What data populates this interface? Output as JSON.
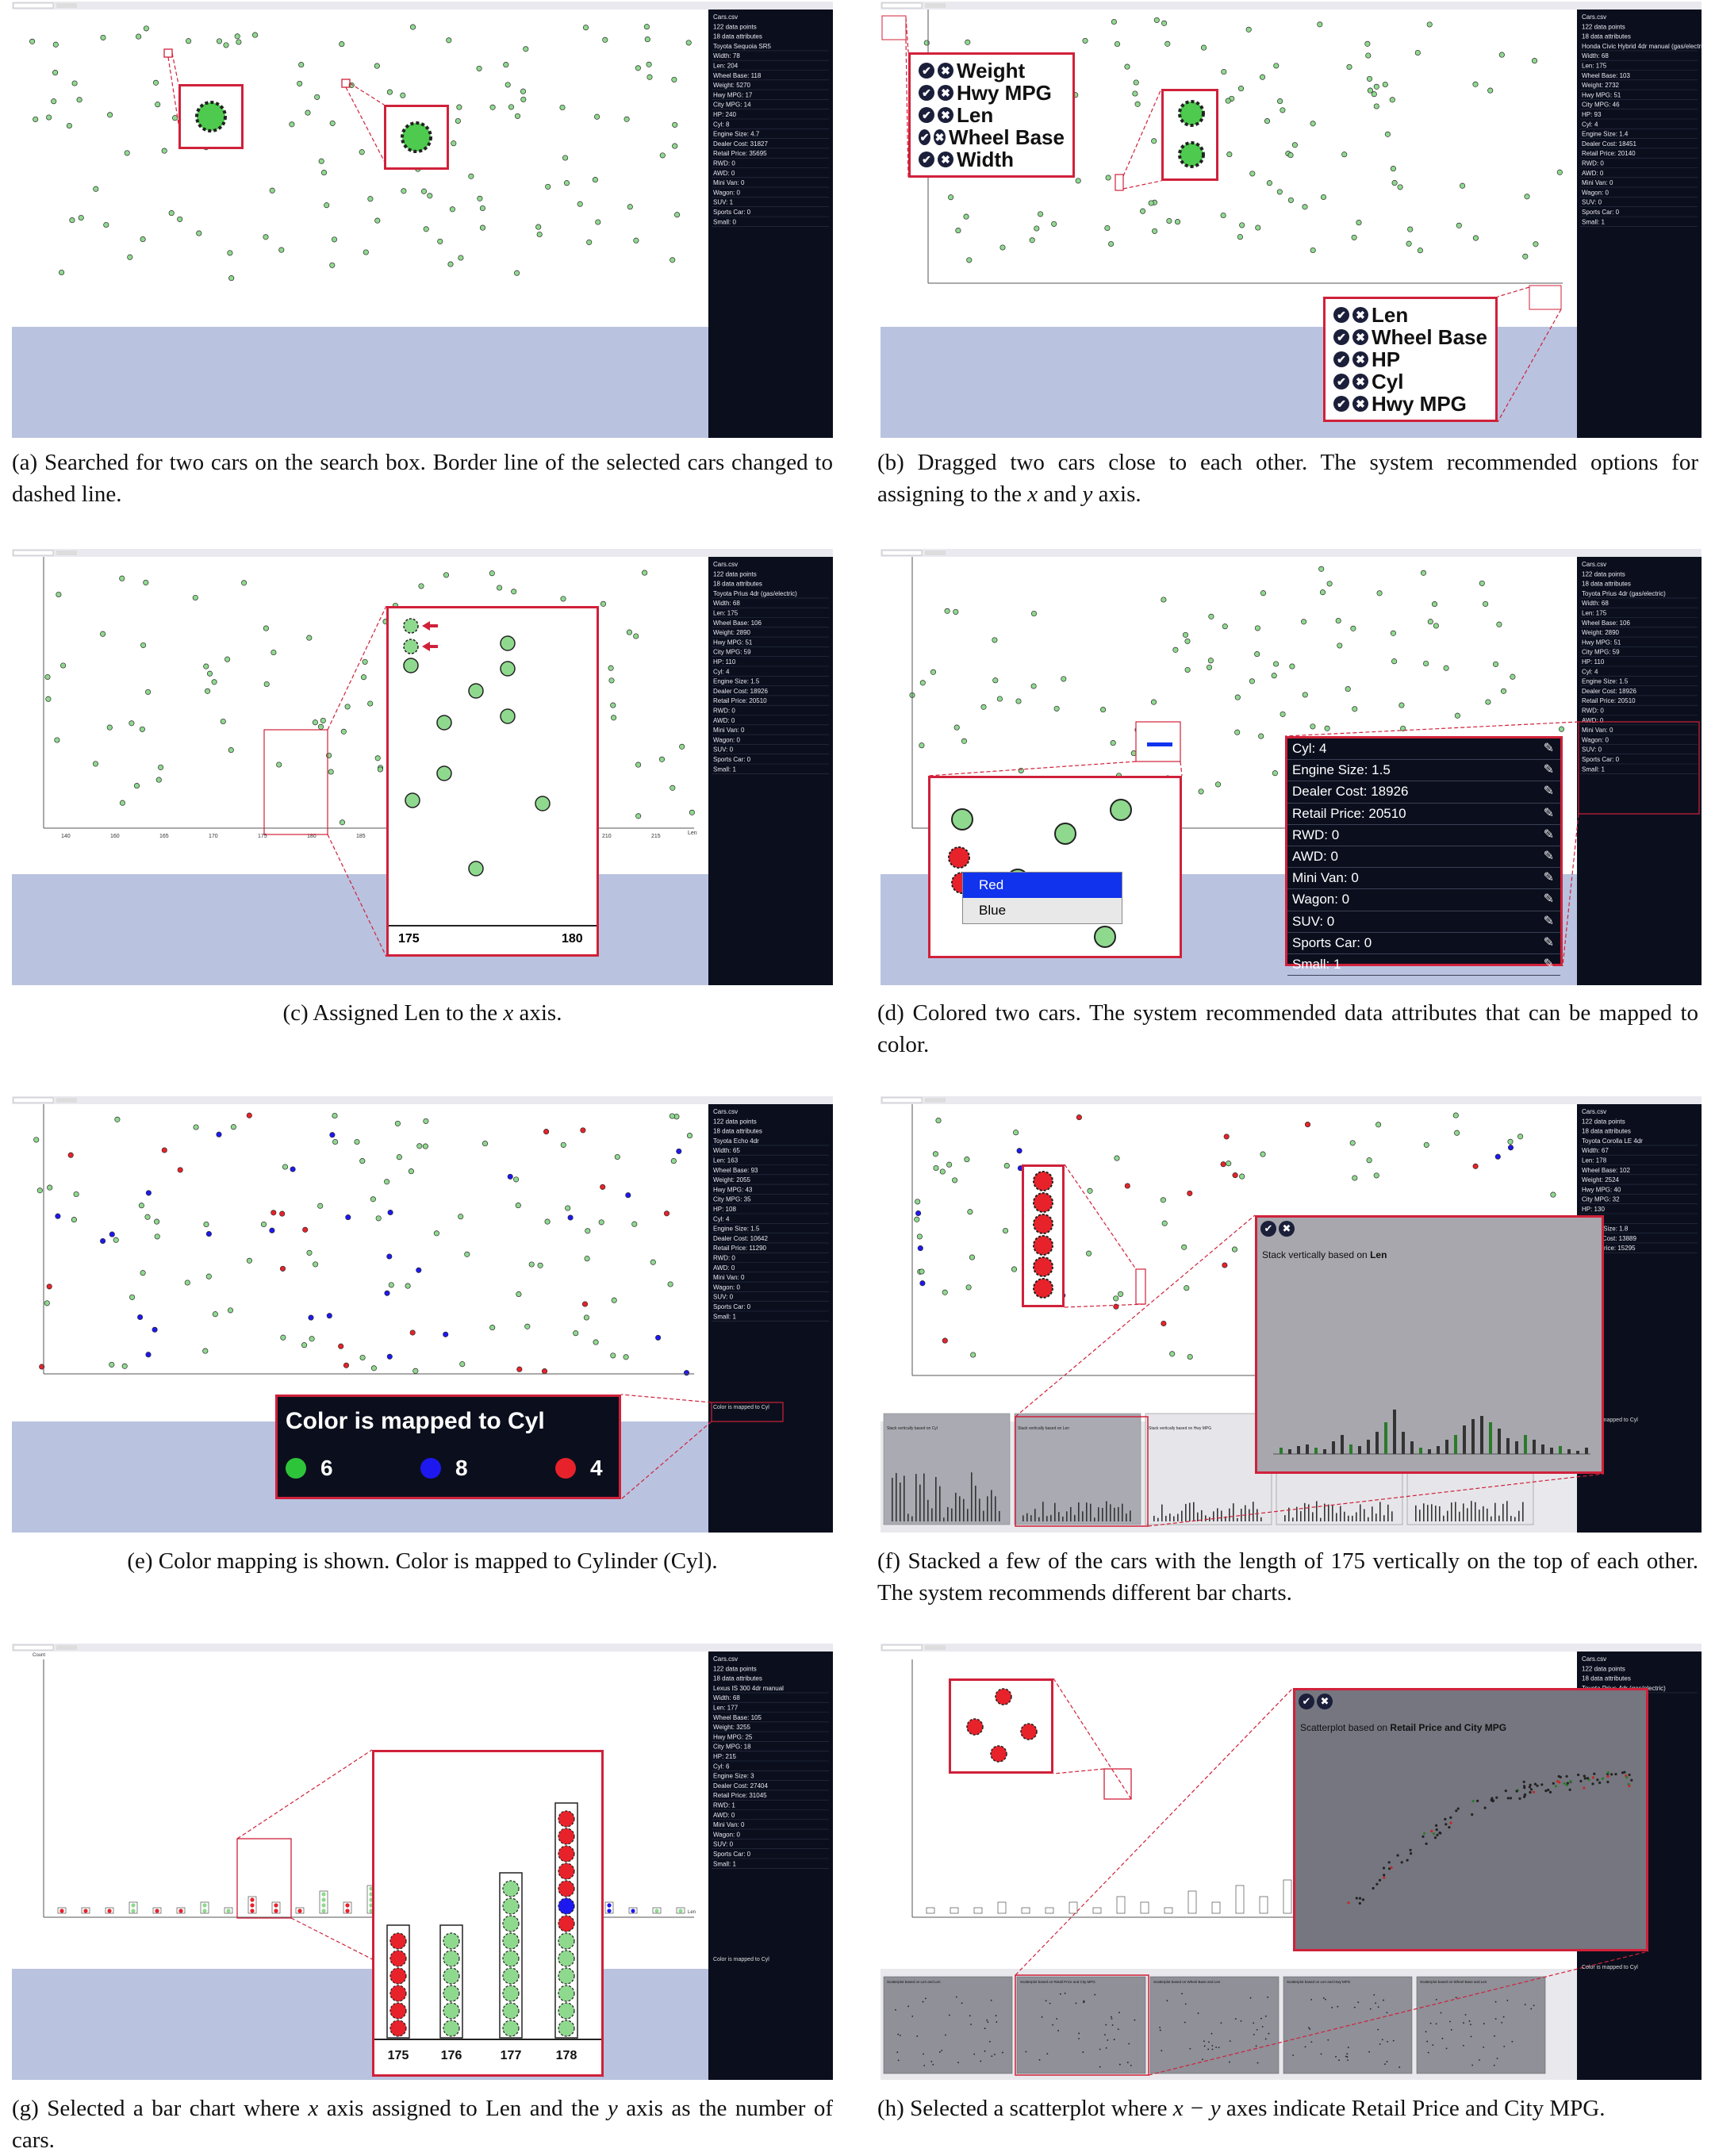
{
  "panels": {
    "a": {
      "search_text": "Enter Car Name",
      "clear_label": "Search Clear",
      "info": {
        "file": "Cars.csv",
        "points": "122 data points",
        "attrs": "18 data attributes",
        "car": "Toyota Sequoia SR5",
        "rows": [
          "Width: 78",
          "Len: 204",
          "Wheel Base: 118",
          "Weight: 5270",
          "Hwy MPG: 17",
          "City MPG: 14",
          "HP: 240",
          "Cyl: 8",
          "Engine Size: 4.7",
          "Dealer Cost: 31827",
          "Retail Price: 35695",
          "RWD: 0",
          "AWD: 0",
          "Mini Van: 0",
          "Wagon: 0",
          "SUV: 1",
          "Sports Car: 0",
          "Small: 0"
        ]
      }
    },
    "b": {
      "info": {
        "file": "Cars.csv",
        "points": "122 data points",
        "attrs": "18 data attributes",
        "car": "Honda Civic Hybrid 4dr manual (gas/electric)",
        "rows": [
          "Width: 68",
          "Len: 175",
          "Wheel Base: 103",
          "Weight: 2732",
          "Hwy MPG: 51",
          "City MPG: 46",
          "HP: 93",
          "Cyl: 4",
          "Engine Size: 1.4",
          "Dealer Cost: 18451",
          "Retail Price: 20140",
          "RWD: 0",
          "AWD: 0",
          "Mini Van: 0",
          "Wagon: 0",
          "SUV: 0",
          "Sports Car: 0",
          "Small: 1"
        ]
      },
      "options_top": [
        "Weight",
        "Hwy MPG",
        "Len",
        "Wheel Base",
        "Width"
      ],
      "options_bottom": [
        "Len",
        "Wheel Base",
        "HP",
        "Cyl",
        "Hwy MPG"
      ]
    },
    "c": {
      "info": {
        "file": "Cars.csv",
        "points": "122 data points",
        "attrs": "18 data attributes",
        "car": "Toyota Prius 4dr (gas/electric)",
        "rows": [
          "Width: 68",
          "Len: 175",
          "Wheel Base: 106",
          "Weight: 2890",
          "Hwy MPG: 51",
          "City MPG: 59",
          "HP: 110",
          "Cyl: 4",
          "Engine Size: 1.5",
          "Dealer Cost: 18926",
          "Retail Price: 20510",
          "RWD: 0",
          "AWD: 0",
          "Mini Van: 0",
          "Wagon: 0",
          "SUV: 0",
          "Sports Car: 0",
          "Small: 1"
        ]
      },
      "x_label": "Len",
      "ticks": [
        "140",
        "160",
        "165",
        "170",
        "175",
        "180",
        "185",
        "190",
        "195",
        "200",
        "205",
        "210",
        "215"
      ],
      "zoom_ticks": [
        "175",
        "180"
      ]
    },
    "d": {
      "info": {
        "file": "Cars.csv",
        "points": "122 data points",
        "attrs": "18 data attributes",
        "car": "Toyota Prius 4dr (gas/electric)",
        "rows": [
          "Width: 68",
          "Len: 175",
          "Wheel Base: 106",
          "Weight: 2890",
          "Hwy MPG: 51",
          "City MPG: 59",
          "HP: 110",
          "Cyl: 4",
          "Engine Size: 1.5",
          "Dealer Cost: 18926",
          "Retail Price: 20510",
          "RWD: 0",
          "AWD: 0",
          "Mini Van: 0",
          "Wagon: 0",
          "SUV: 0",
          "Sports Car: 0",
          "Small: 1"
        ]
      },
      "popup_rows": [
        "Cyl: 4",
        "Engine Size: 1.5",
        "Dealer Cost: 18926",
        "Retail Price: 20510",
        "RWD: 0",
        "AWD: 0",
        "Mini Van: 0",
        "Wagon: 0",
        "SUV: 0",
        "Sports Car: 0",
        "Small: 1"
      ],
      "menu": [
        "Red",
        "Blue"
      ]
    },
    "e": {
      "info": {
        "file": "Cars.csv",
        "points": "122 data points",
        "attrs": "18 data attributes",
        "car": "Toyota Echo 4dr",
        "rows": [
          "Width: 65",
          "Len: 163",
          "Wheel Base: 93",
          "Weight: 2055",
          "Hwy MPG: 43",
          "City MPG: 35",
          "HP: 108",
          "Cyl: 4",
          "Engine Size: 1.5",
          "Dealer Cost: 10642",
          "Retail Price: 11290",
          "RWD: 0",
          "AWD: 0",
          "Mini Van: 0",
          "Wagon: 0",
          "SUV: 0",
          "Sports Car: 0",
          "Small: 1"
        ]
      },
      "legend_title": "Color is mapped to Cyl",
      "legend_small": "Color is mapped to Cyl",
      "legend": [
        {
          "color": "#2ec43a",
          "value": "6"
        },
        {
          "color": "#1e18f0",
          "value": "8"
        },
        {
          "color": "#e8222a",
          "value": "4"
        }
      ]
    },
    "f": {
      "info": {
        "file": "Cars.csv",
        "points": "122 data points",
        "attrs": "18 data attributes",
        "car": "Toyota Corolla LE 4dr",
        "rows": [
          "Width: 67",
          "Len: 178",
          "Wheel Base: 102",
          "Weight: 2524",
          "Hwy MPG: 40",
          "City MPG: 32",
          "HP: 130",
          "Cyl: 4",
          "Engine Size: 1.8",
          "Dealer Cost: 13889",
          "Retail Price: 15295"
        ]
      },
      "rec_title": "Stack vertically based on",
      "rec_attr": "Len",
      "thumbs": [
        "Stack vertically based on Cyl",
        "Stack vertically based on Len",
        "Stack vertically based on Hwy MPG"
      ],
      "legend_small": "Color is mapped to Cyl"
    },
    "g": {
      "info": {
        "file": "Cars.csv",
        "points": "122 data points",
        "attrs": "18 data attributes",
        "car": "Lexus IS 300 4dr manual",
        "rows": [
          "Width: 68",
          "Len: 177",
          "Wheel Base: 105",
          "Weight: 3255",
          "Hwy MPG: 25",
          "City MPG: 18",
          "HP: 215",
          "Cyl: 6",
          "Engine Size: 3",
          "Dealer Cost: 27404",
          "Retail Price: 31045",
          "RWD: 1",
          "AWD: 0",
          "Mini Van: 0",
          "Wagon: 0",
          "SUV: 0",
          "Sports Car: 0",
          "Small: 1"
        ]
      },
      "count_label": "Count",
      "x_label": "Len",
      "bar_labels": [
        "175",
        "176",
        "177",
        "178"
      ],
      "legend_small": "Color is mapped to Cyl"
    },
    "h": {
      "info": {
        "file": "Cars.csv",
        "points": "122 data points",
        "attrs": "18 data attributes",
        "car": "Toyota Prius 4dr (gas/electric)",
        "rows": []
      },
      "rec_title": "Scatterplot based on",
      "rec_attr": "Retail Price and City MPG",
      "thumbs": [
        "Scatterplot based on Len and Len",
        "Scatterplot based on Retail Price and City MPG",
        "Scatterplot based on Wheel Base and Len",
        "Scatterplot based on Len and Hwy MPG",
        "Scatterplot based on Wheel Base and Len"
      ],
      "legend_small": "Color is mapped to Cyl"
    }
  },
  "captions": {
    "a": {
      "prefix": "(a) Searched for two cars on the search box.  Border line of the selected cars changed to dashed line."
    },
    "b": {
      "p1": "(b) Dragged two cars close to each other.  The system recommended options for assigning to the ",
      "x": "x",
      "p2": " and ",
      "y": "y",
      "p3": " axis."
    },
    "c": {
      "p1": "(c) Assigned Len to the ",
      "x": "x",
      "p2": " axis."
    },
    "d": {
      "p1": "(d) Colored two cars.  The system recommended data attributes that can be mapped to color."
    },
    "e": {
      "p1": "(e) Color mapping is shown. Color is mapped to Cylinder (Cyl)."
    },
    "f": {
      "p1": "(f) Stacked a few of the cars with the length of 175 vertically on the top of each other. The system recommends different bar charts."
    },
    "g": {
      "p1": "(g) Selected a bar chart where ",
      "x": "x",
      "p2": " axis assigned to Len and the ",
      "y": "y",
      "p3": " axis as the number of cars."
    },
    "h": {
      "p1": "(h) Selected a scatterplot where ",
      "xy": "x − y",
      "p2": " axes indicate Retail Price and City MPG."
    }
  },
  "colors": {
    "green": "#8fd98f",
    "red": "#e8222a",
    "blue": "#1e18f0",
    "accent": "#d0213a",
    "sidebar": "#0b0f1d",
    "bottom": "#b9c3e0"
  }
}
